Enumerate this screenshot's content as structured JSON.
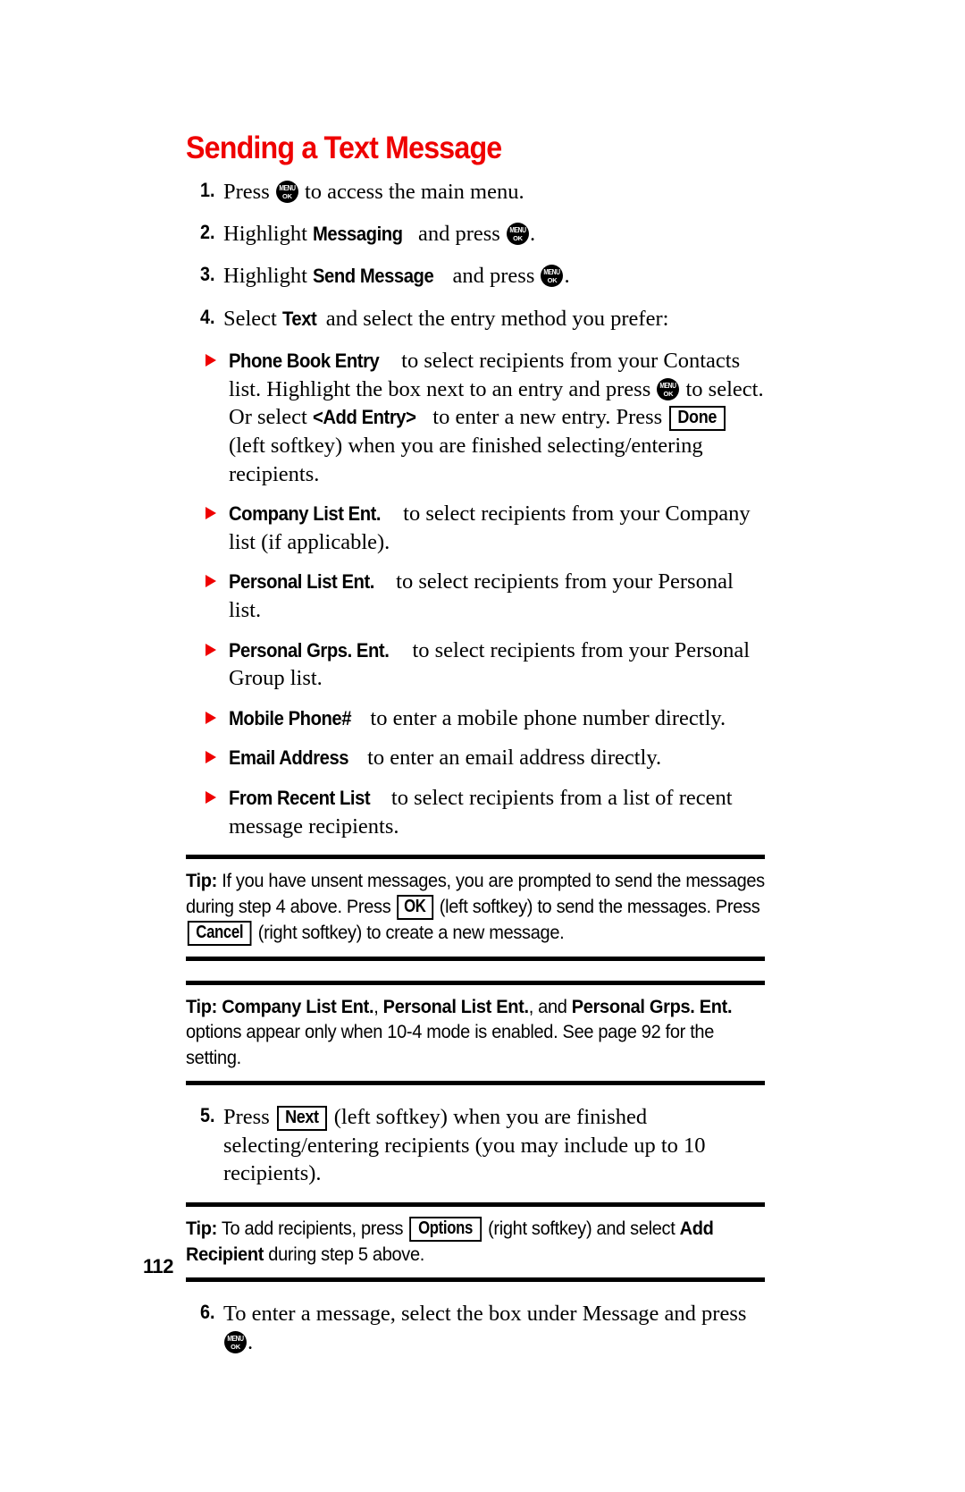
{
  "document": {
    "heading": "Sending a Text Message",
    "page_number": "112"
  },
  "icons": {
    "menu_key_top": "MENU",
    "menu_key_bottom": "OK",
    "bullet": "red-triangle"
  },
  "steps": [
    {
      "number": "1.",
      "parts": [
        {
          "type": "text",
          "value": "Press "
        },
        {
          "type": "menukey"
        },
        {
          "type": "text",
          "value": " to access the main menu."
        }
      ]
    },
    {
      "number": "2.",
      "parts": [
        {
          "type": "text",
          "value": "Highlight "
        },
        {
          "type": "ui",
          "value": "Messaging"
        },
        {
          "type": "text",
          "value": " and press "
        },
        {
          "type": "menukey"
        },
        {
          "type": "text",
          "value": "."
        }
      ]
    },
    {
      "number": "3.",
      "parts": [
        {
          "type": "text",
          "value": "Highlight "
        },
        {
          "type": "ui",
          "value": "Send Message"
        },
        {
          "type": "text",
          "value": " and press "
        },
        {
          "type": "menukey"
        },
        {
          "type": "text",
          "value": "."
        }
      ]
    },
    {
      "number": "4.",
      "parts": [
        {
          "type": "text",
          "value": "Select "
        },
        {
          "type": "ui",
          "value": "Text"
        },
        {
          "type": "text",
          "value": " and select the entry method you prefer:"
        }
      ]
    }
  ],
  "bullets": [
    {
      "parts": [
        {
          "type": "ui",
          "value": "Phone Book Entry"
        },
        {
          "type": "text",
          "value": " to select recipients from your Contacts list. Highlight the box next to an entry and press "
        },
        {
          "type": "menukey"
        },
        {
          "type": "text",
          "value": " to select. Or select "
        },
        {
          "type": "ui",
          "value": "<Add Entry>"
        },
        {
          "type": "text",
          "value": " to enter a new entry. Press "
        },
        {
          "type": "softkey",
          "value": "Done"
        },
        {
          "type": "text",
          "value": " (left softkey) when you are finished selecting/entering recipients."
        }
      ]
    },
    {
      "parts": [
        {
          "type": "ui",
          "value": "Company List Ent."
        },
        {
          "type": "text",
          "value": " to select recipients from your Company list (if applicable)."
        }
      ]
    },
    {
      "parts": [
        {
          "type": "ui",
          "value": "Personal List Ent."
        },
        {
          "type": "text",
          "value": " to select recipients from your Personal list."
        }
      ]
    },
    {
      "parts": [
        {
          "type": "ui",
          "value": "Personal Grps. Ent."
        },
        {
          "type": "text",
          "value": " to select recipients from your Personal Group list."
        }
      ]
    },
    {
      "parts": [
        {
          "type": "ui",
          "value": "Mobile Phone#"
        },
        {
          "type": "text",
          "value": " to enter a mobile phone number directly."
        }
      ]
    },
    {
      "parts": [
        {
          "type": "ui",
          "value": "Email Address"
        },
        {
          "type": "text",
          "value": " to enter an email address directly."
        }
      ]
    },
    {
      "parts": [
        {
          "type": "ui",
          "value": "From Recent List"
        },
        {
          "type": "text",
          "value": " to select recipients from a list of recent message recipients."
        }
      ]
    }
  ],
  "tips": [
    {
      "label": "Tip:",
      "parts": [
        {
          "type": "text",
          "value": " If you have unsent messages, you are prompted to send the messages during step 4 above. Press "
        },
        {
          "type": "softkey",
          "value": "OK"
        },
        {
          "type": "text",
          "value": " (left softkey) to send the messages. Press "
        },
        {
          "type": "softkey",
          "value": "Cancel"
        },
        {
          "type": "text",
          "value": " (right softkey) to create a new message."
        }
      ]
    },
    {
      "label": "Tip:",
      "parts": [
        {
          "type": "text",
          "value": " "
        },
        {
          "type": "bold",
          "value": "Company List Ent."
        },
        {
          "type": "text",
          "value": ", "
        },
        {
          "type": "bold",
          "value": "Personal List Ent."
        },
        {
          "type": "text",
          "value": ", and "
        },
        {
          "type": "bold",
          "value": "Personal Grps. Ent."
        },
        {
          "type": "text",
          "value": " options appear only when 10-4 mode is enabled. See page 92 for the setting."
        }
      ]
    },
    {
      "label": "Tip:",
      "parts": [
        {
          "type": "text",
          "value": " To add recipients, press "
        },
        {
          "type": "softkey",
          "value": "Options"
        },
        {
          "type": "text",
          "value": " (right softkey) and select "
        },
        {
          "type": "bold",
          "value": "Add Recipient"
        },
        {
          "type": "text",
          "value": " during step 5 above."
        }
      ]
    }
  ],
  "steps_after": [
    {
      "number": "5.",
      "parts": [
        {
          "type": "text",
          "value": "Press "
        },
        {
          "type": "softkey",
          "value": "Next"
        },
        {
          "type": "text",
          "value": " (left softkey) when you are finished selecting/entering recipients (you may include up to 10 recipients)."
        }
      ]
    }
  ],
  "steps_final": [
    {
      "number": "6.",
      "parts": [
        {
          "type": "text",
          "value": "To enter a message, select the box under Message and press "
        },
        {
          "type": "menukey"
        },
        {
          "type": "text",
          "value": "."
        }
      ]
    }
  ]
}
